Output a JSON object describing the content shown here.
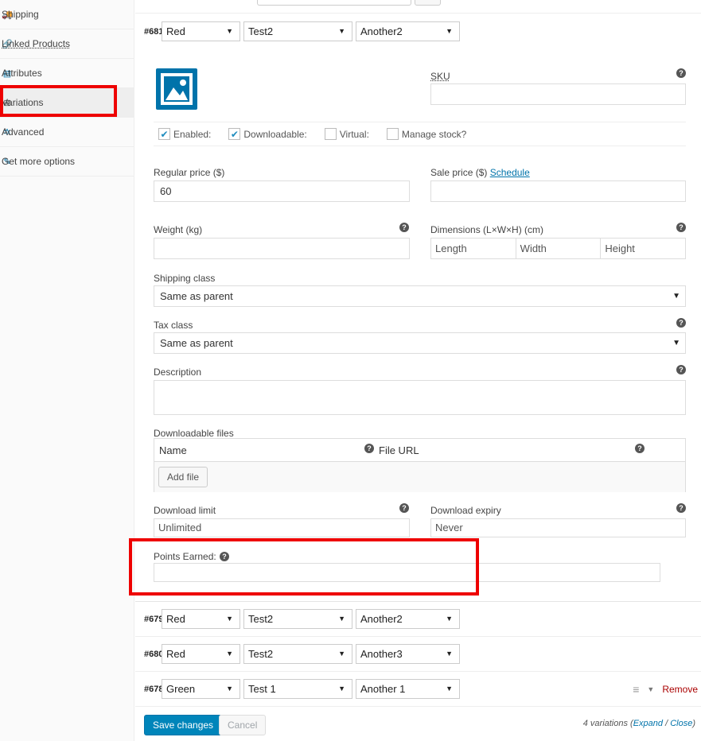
{
  "sidebar": {
    "items": [
      {
        "label": "Shipping",
        "icon": "truck-icon"
      },
      {
        "label": "Linked Products",
        "icon": "link-icon"
      },
      {
        "label": "Attributes",
        "icon": "list-icon"
      },
      {
        "label": "Variations",
        "icon": "grid-icon"
      },
      {
        "label": "Advanced",
        "icon": "gear-icon"
      },
      {
        "label": "Get more options",
        "icon": "plugin-icon"
      }
    ]
  },
  "variations": {
    "expanded": {
      "id": "#681",
      "attr1": "Red",
      "attr2": "Test2",
      "attr3": "Another2"
    },
    "rows": [
      {
        "id": "#679",
        "attr1": "Red",
        "attr2": "Test2",
        "attr3": "Another2"
      },
      {
        "id": "#680",
        "attr1": "Red",
        "attr2": "Test2",
        "attr3": "Another3"
      },
      {
        "id": "#678",
        "attr1": "Green",
        "attr2": "Test 1",
        "attr3": "Another 1"
      }
    ],
    "remove_label": "Remove"
  },
  "form": {
    "sku_label": "SKU",
    "enabled_label": "Enabled:",
    "downloadable_label": "Downloadable:",
    "virtual_label": "Virtual:",
    "manage_stock_label": "Manage stock?",
    "regular_price_label": "Regular price ($)",
    "regular_price_value": "60",
    "sale_price_label": "Sale price ($)",
    "schedule_link": "Schedule",
    "weight_label": "Weight (kg)",
    "dimensions_label": "Dimensions (L×W×H) (cm)",
    "length_placeholder": "Length",
    "width_placeholder": "Width",
    "height_placeholder": "Height",
    "shipping_class_label": "Shipping class",
    "shipping_class_value": "Same as parent",
    "tax_class_label": "Tax class",
    "tax_class_value": "Same as parent",
    "description_label": "Description",
    "downloadable_files_label": "Downloadable files",
    "name_col": "Name",
    "file_url_col": "File URL",
    "add_file_button": "Add file",
    "download_limit_label": "Download limit",
    "download_limit_placeholder": "Unlimited",
    "download_expiry_label": "Download expiry",
    "download_expiry_placeholder": "Never",
    "points_earned_label": "Points Earned:"
  },
  "footer": {
    "save_label": "Save changes",
    "cancel_label": "Cancel",
    "count_text": "4 variations (",
    "expand_link": "Expand",
    "sep": " / ",
    "close_link": "Close",
    "close_paren": ")"
  },
  "colors": {
    "accent": "#0073aa",
    "primary_button": "#0085ba",
    "highlight": "#ee0000",
    "remove": "#aa0000"
  }
}
